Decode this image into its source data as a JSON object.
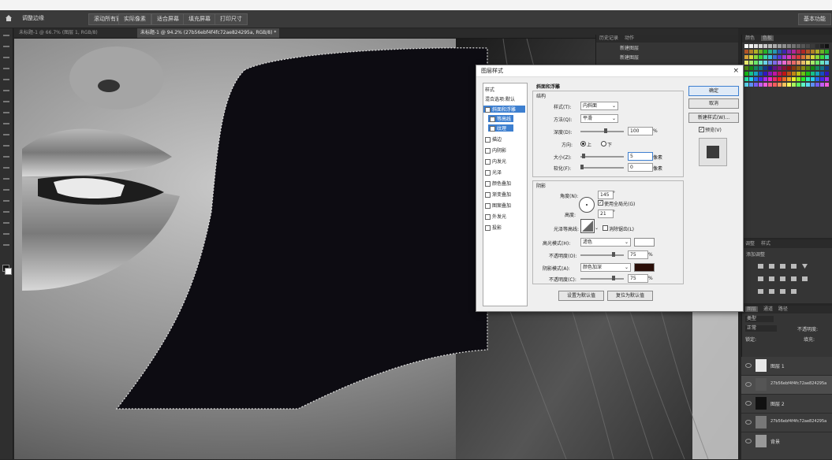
{
  "options_bar": {
    "home_icon": "home-icon",
    "items": [
      "调整边缘",
      "滚动所有窗口",
      "实际像素",
      "适合屏幕",
      "填充屏幕",
      "打印尺寸"
    ],
    "right_label": "基本功能"
  },
  "tabs": [
    {
      "label": "未标题-1 @ 66.7% (图层 1, RGB/8)",
      "active": false
    },
    {
      "label": "未标题-1 @ 94.2% (27b56ebf4f4fc72ae824295a, RGB/8) *",
      "active": true
    }
  ],
  "history_panel": {
    "tabs": [
      "历史记录",
      "动作"
    ],
    "items": [
      "新建图层",
      "新建图层"
    ]
  },
  "swatch_panel": {
    "tabs": [
      "颜色",
      "色板"
    ]
  },
  "adjust_panel": {
    "tabs": [
      "调整",
      "样式"
    ],
    "title": "添加调整"
  },
  "layers_panel": {
    "tabs": [
      "图层",
      "通道",
      "路径"
    ],
    "kind_label": "类型",
    "blend_mode": "正常",
    "opacity_label": "不透明度:",
    "lock_label": "锁定:",
    "fill_label": "填充:",
    "layers": [
      {
        "name": "图层 1",
        "selected": false
      },
      {
        "name": "27b56ebf4f4fc72ae824295a",
        "selected": true
      },
      {
        "name": "图层 2",
        "selected": false
      },
      {
        "name": "27b56ebf4f4fc72ae824295a",
        "selected": false
      },
      {
        "name": "背景",
        "selected": false
      }
    ]
  },
  "dialog": {
    "title": "图层样式",
    "close": "×",
    "style_list": [
      {
        "label": "样式",
        "type": "header"
      },
      {
        "label": "混合选项:默认",
        "type": "header"
      },
      {
        "label": "斜面和浮雕",
        "type": "selected"
      },
      {
        "label": "等高线",
        "type": "sub"
      },
      {
        "label": "纹理",
        "type": "sub"
      },
      {
        "label": "描边",
        "type": "item"
      },
      {
        "label": "内阴影",
        "type": "item"
      },
      {
        "label": "内发光",
        "type": "item"
      },
      {
        "label": "光泽",
        "type": "item"
      },
      {
        "label": "颜色叠加",
        "type": "item"
      },
      {
        "label": "渐变叠加",
        "type": "item"
      },
      {
        "label": "图案叠加",
        "type": "item"
      },
      {
        "label": "外发光",
        "type": "item"
      },
      {
        "label": "投影",
        "type": "item"
      }
    ],
    "section_title": "斜面和浮雕",
    "structure": {
      "title": "结构",
      "style_label": "样式(T):",
      "style_value": "内斜面",
      "technique_label": "方法(Q):",
      "technique_value": "平滑",
      "depth_label": "深度(D):",
      "depth_value": "100",
      "depth_unit": "%",
      "direction_label": "方向:",
      "direction_up": "上",
      "direction_down": "下",
      "size_label": "大小(Z):",
      "size_value": "5",
      "size_unit": "像素",
      "soften_label": "软化(F):",
      "soften_value": "0",
      "soften_unit": "像素"
    },
    "shading": {
      "title": "阴影",
      "angle_label": "角度(N):",
      "angle_value": "145",
      "angle_unit": "°",
      "global_light_label": "使用全局光(G)",
      "altitude_label": "高度:",
      "altitude_value": "21",
      "altitude_unit": "°",
      "gloss_label": "光泽等高线:",
      "antialias_label": "消除锯齿(L)",
      "highlight_mode_label": "高光模式(H):",
      "highlight_mode_value": "滤色",
      "highlight_opacity_label": "不透明度(O):",
      "highlight_opacity_value": "75",
      "shadow_mode_label": "阴影模式(A):",
      "shadow_mode_value": "颜色加深",
      "shadow_opacity_label": "不透明度(C):",
      "shadow_opacity_value": "75",
      "percent": "%",
      "shadow_color": "#2a0e08"
    },
    "set_default": "设置为默认值",
    "reset_default": "复位为默认值",
    "ok": "确定",
    "cancel": "取消",
    "new_style": "新建样式(W)...",
    "preview_label": "预览(V)"
  },
  "colors": {
    "accent": "#3d7fd0",
    "canvas_fill": "#0d0c12"
  }
}
